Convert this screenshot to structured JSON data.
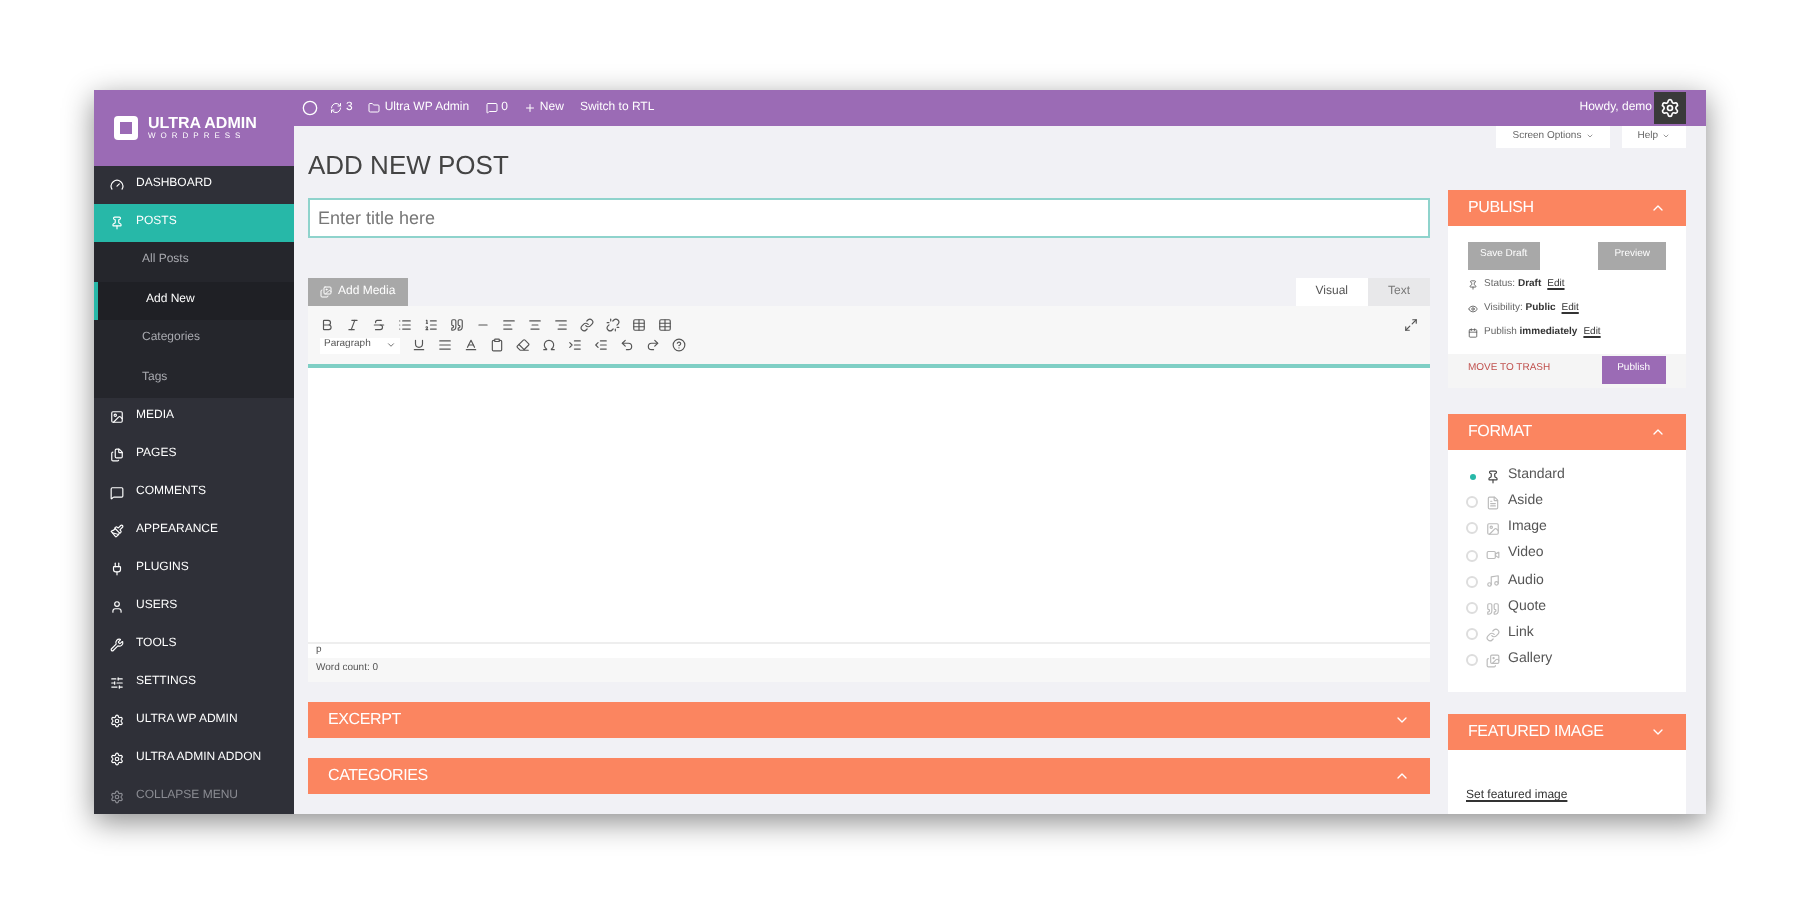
{
  "topbar": {
    "updates": "3",
    "site": "Ultra WP Admin",
    "comments": "0",
    "new": "New",
    "rtl": "Switch to RTL",
    "howdy": "Howdy, demo"
  },
  "logo": {
    "title": "ULTRA ADMIN",
    "subtitle": "WORDPRESS"
  },
  "sidebar": {
    "items": [
      {
        "label": "DASHBOARD",
        "selected": false,
        "disabled": false
      },
      {
        "label": "POSTS",
        "selected": true,
        "disabled": false,
        "children": [
          {
            "label": "All Posts",
            "selected": false
          },
          {
            "label": "Add New",
            "selected": true
          },
          {
            "label": "Categories",
            "selected": false
          },
          {
            "label": "Tags",
            "selected": false
          }
        ]
      },
      {
        "label": "MEDIA",
        "selected": false,
        "disabled": false
      },
      {
        "label": "PAGES",
        "selected": false,
        "disabled": false
      },
      {
        "label": "COMMENTS",
        "selected": false,
        "disabled": false
      },
      {
        "label": "APPEARANCE",
        "selected": false,
        "disabled": false
      },
      {
        "label": "PLUGINS",
        "selected": false,
        "disabled": false
      },
      {
        "label": "USERS",
        "selected": false,
        "disabled": false
      },
      {
        "label": "TOOLS",
        "selected": false,
        "disabled": false
      },
      {
        "label": "SETTINGS",
        "selected": false,
        "disabled": false
      },
      {
        "label": "ULTRA WP ADMIN",
        "selected": false,
        "disabled": false
      },
      {
        "label": "ULTRA ADMIN ADDON",
        "selected": false,
        "disabled": false
      },
      {
        "label": "COLLAPSE MENU",
        "selected": false,
        "disabled": true
      }
    ]
  },
  "screen_tabs": [
    "Screen Options",
    "Help"
  ],
  "page_title": "ADD NEW POST",
  "title_field": {
    "placeholder": "Enter title here"
  },
  "editor": {
    "add_media": "Add Media",
    "tabs": [
      {
        "label": "Visual",
        "selected": true
      },
      {
        "label": "Text",
        "selected": false
      }
    ],
    "format_select": "Paragraph",
    "path": "p",
    "word_count": "Word count: 0"
  },
  "boxes": [
    {
      "title": "EXCERPT",
      "expanded": false
    },
    {
      "title": "CATEGORIES",
      "expanded": true
    }
  ],
  "publish": {
    "title": "PUBLISH",
    "save_draft": "Save Draft",
    "preview": "Preview",
    "rows": [
      {
        "label": "Status:",
        "value": "Draft",
        "link": "Edit"
      },
      {
        "label": "Visibility:",
        "value": "Public",
        "link": "Edit"
      },
      {
        "label": "Publish",
        "value": "immediately",
        "link": "Edit"
      }
    ],
    "trash": "MOVE TO TRASH",
    "publish_button": "Publish"
  },
  "format": {
    "title": "FORMAT",
    "options": [
      {
        "label": "Standard",
        "selected": true
      },
      {
        "label": "Aside",
        "selected": false
      },
      {
        "label": "Image",
        "selected": false
      },
      {
        "label": "Video",
        "selected": false
      },
      {
        "label": "Audio",
        "selected": false
      },
      {
        "label": "Quote",
        "selected": false
      },
      {
        "label": "Link",
        "selected": false
      },
      {
        "label": "Gallery",
        "selected": false
      }
    ]
  },
  "featured": {
    "title": "FEATURED IMAGE",
    "link": "Set featured image"
  }
}
